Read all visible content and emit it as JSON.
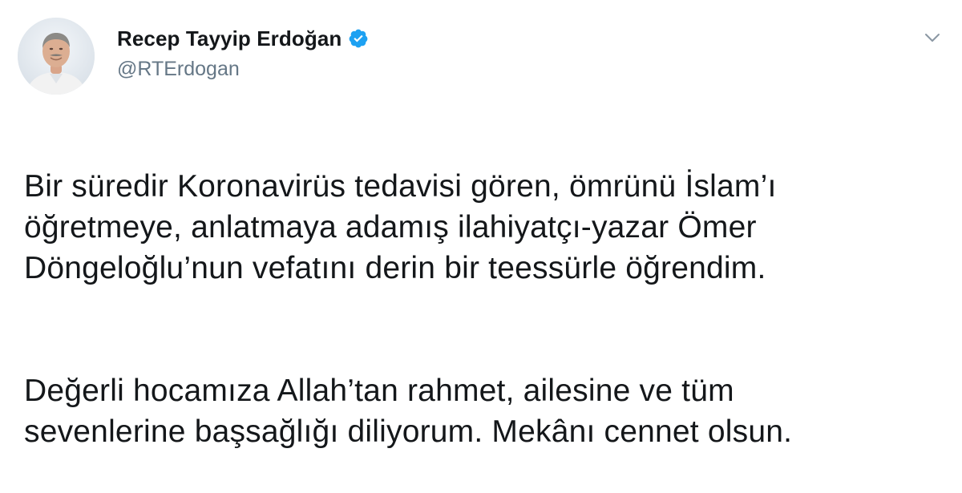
{
  "tweet": {
    "author": {
      "display_name": "Recep Tayyip Erdoğan",
      "handle": "@RTErdogan",
      "verified": true,
      "verified_icon": "verified-badge-icon",
      "avatar_icon": "profile-photo"
    },
    "menu_icon": "chevron-down-icon",
    "paragraphs": [
      "Bir süredir Koronavirüs tedavisi gören, ömrünü İslam’ı\nöğretmeye, anlatmaya adamış ilahiyatçı-yazar Ömer\nDöngeloğlu’nun vefatını derin bir teessürle öğrendim.",
      "Değerli hocamıza Allah’tan rahmet, ailesine ve tüm\nsevenlerine başsağlığı diliyorum. Mekânı cennet olsun."
    ]
  },
  "colors": {
    "text_primary": "#14171a",
    "text_secondary": "#657786",
    "verified_blue": "#1da1f2",
    "background": "#ffffff"
  }
}
